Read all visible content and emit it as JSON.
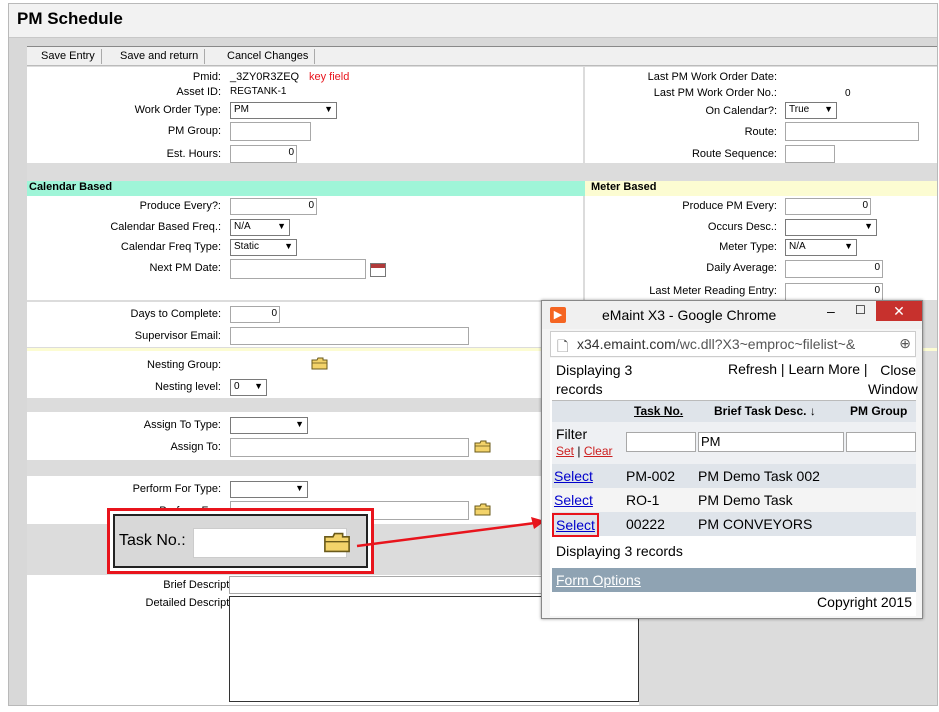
{
  "page": {
    "title": "PM Schedule"
  },
  "toolbar": {
    "save_entry": "Save Entry",
    "save_return": "Save and return",
    "cancel": "Cancel Changes"
  },
  "form": {
    "pmid_label": "Pmid:",
    "pmid_value": "_3ZY0R3ZEQ",
    "pmid_note": "key field",
    "asset_label": "Asset ID:",
    "asset_value": "REGTANK-1",
    "wotype_label": "Work Order Type:",
    "wotype_value": "PM",
    "pmgroup_label": "PM Group:",
    "esthours_label": "Est. Hours:",
    "esthours_value": "0",
    "lastpmdate_label": "Last PM Work Order Date:",
    "lastpmno_label": "Last PM Work Order No.:",
    "lastpmno_value": "0",
    "oncal_label": "On Calendar?:",
    "oncal_value": "True",
    "route_label": "Route:",
    "routeseq_label": "Route Sequence:",
    "calendar_header": "Calendar Based",
    "meter_header": "Meter Based",
    "produce_every_label": "Produce Every?:",
    "produce_every_value": "0",
    "calfreq_label": "Calendar Based Freq.:",
    "calfreq_value": "N/A",
    "calfreqtype_label": "Calendar Freq Type:",
    "calfreqtype_value": "Static",
    "nextpm_label": "Next PM Date:",
    "produce_pm_label": "Produce PM Every:",
    "produce_pm_value": "0",
    "occurs_label": "Occurs Desc.:",
    "metertype_label": "Meter Type:",
    "metertype_value": "N/A",
    "dailyavg_label": "Daily Average:",
    "dailyavg_value": "0",
    "lastmeter_label": "Last Meter Reading Entry:",
    "lastmeter_value": "0",
    "days_label": "Days to Complete:",
    "days_value": "0",
    "supervisor_label": "Supervisor Email:",
    "nesting_group_label": "Nesting Group:",
    "nesting_level_label": "Nesting level:",
    "nesting_level_value": "0",
    "assign_type_label": "Assign To Type:",
    "assign_to_label": "Assign To:",
    "perform_type_label": "Perform For Type:",
    "perform_for_label": "Perform For:",
    "task_label": "Task No.:",
    "brief_label": "Brief Description:",
    "detailed_label": "Detailed Description:"
  },
  "popup": {
    "window_title": "eMaint X3 - Google Chrome",
    "url_host": "x34.emaint.com",
    "url_path": "/wc.dll?X3~emproc~filelist~&",
    "displaying_top": "Displaying 3 records",
    "refresh": "Refresh",
    "learn_more": "Learn More",
    "close_window": "Close Window",
    "col_task": "Task No.",
    "col_brief": "Brief Task Desc.",
    "col_pmgroup": "PM Group",
    "filter_label": "Filter",
    "filter_set": "Set",
    "filter_clear": "Clear",
    "filter_brief_value": "PM",
    "rows": [
      {
        "select": "Select",
        "task": "PM-002",
        "desc": "PM Demo Task 002"
      },
      {
        "select": "Select",
        "task": "RO-1",
        "desc": "PM Demo Task"
      },
      {
        "select": "Select",
        "task": "00222",
        "desc": "PM CONVEYORS"
      }
    ],
    "displaying_bottom": "Displaying 3 records",
    "form_options": "Form Options",
    "copyright": "Copyright 2015"
  },
  "colors": {
    "calendar_header": "#9ff5d8",
    "meter_header": "#fcfcd2",
    "highlight": "#e8141c",
    "link": "#0000cc",
    "popup_accent": "#f56522"
  }
}
